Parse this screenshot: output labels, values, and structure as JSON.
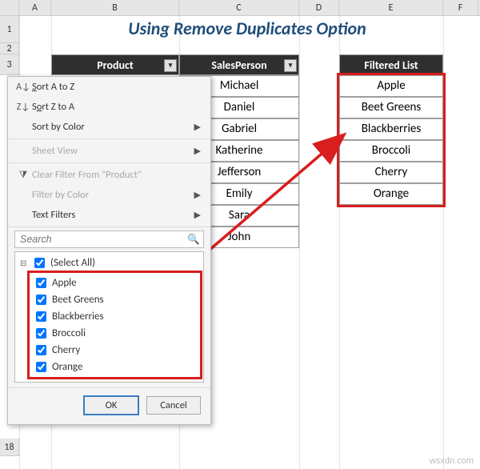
{
  "title": "Using Remove Duplicates Option",
  "columns": {
    "A": "A",
    "B": "B",
    "C": "C",
    "D": "D",
    "E": "E",
    "F": "F"
  },
  "rows": {
    "r1": "1",
    "r2": "2",
    "r3": "3",
    "r18": "18"
  },
  "headers": {
    "product": "Product",
    "salesperson": "SalesPerson",
    "filtered": "Filtered List"
  },
  "salespersons": [
    "Michael",
    "Daniel",
    "Gabriel",
    "Katherine",
    "Jefferson",
    "Emily",
    "Sara",
    "John"
  ],
  "filtered": [
    "Apple",
    "Beet Greens",
    "Blackberries",
    "Broccoli",
    "Cherry",
    "Orange"
  ],
  "menu": {
    "sort_az": "Sort A to Z",
    "sort_za": "Sort Z to A",
    "sort_color": "Sort by Color",
    "sheet_view": "Sheet View",
    "clear_filter": "Clear Filter From \"Product\"",
    "filter_color": "Filter by Color",
    "text_filters": "Text Filters",
    "search_placeholder": "Search",
    "select_all": "(Select All)",
    "items": [
      "Apple",
      "Beet Greens",
      "Blackberries",
      "Broccoli",
      "Cherry",
      "Orange"
    ],
    "ok": "OK",
    "cancel": "Cancel"
  },
  "watermark": "wsxdn.com"
}
